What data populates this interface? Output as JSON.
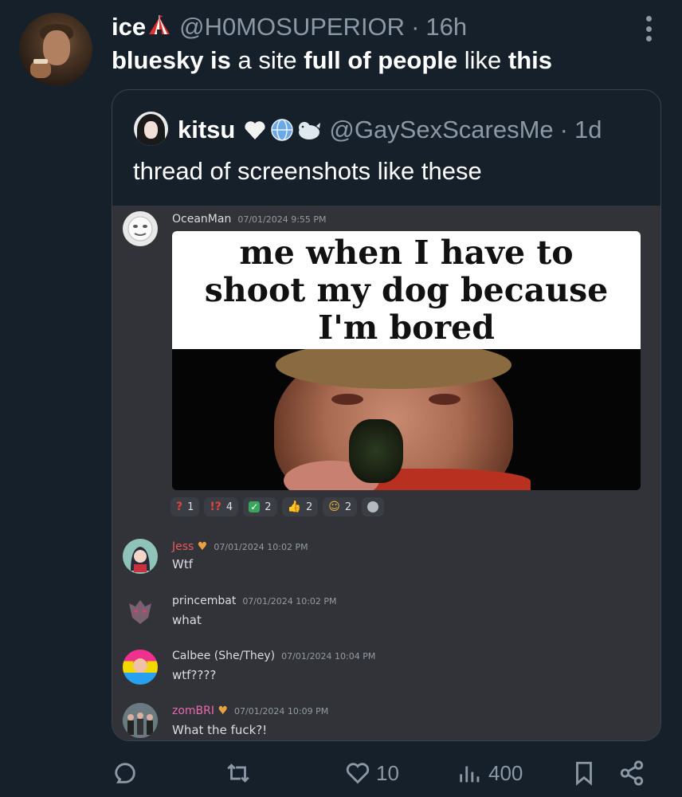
{
  "tweet": {
    "author_name": "ice",
    "author_handle": "@H0MOSUPERIOR",
    "separator": "·",
    "timestamp": "16h",
    "text_parts": [
      "bluesky is",
      " a site ",
      "full of people",
      " like ",
      "this"
    ]
  },
  "quote": {
    "author_name": "kitsu",
    "author_handle": "@GaySexScaresMe",
    "separator": "·",
    "timestamp": "1d",
    "text": "thread of screenshots like these"
  },
  "discord": {
    "first": {
      "username": "OceanMan",
      "timestamp": "07/01/2024 9:55 PM",
      "meme_lines": [
        "me when I have to",
        "shoot my dog because",
        "I'm bored"
      ]
    },
    "reactions": [
      {
        "icon": "?",
        "count": "1",
        "color": "#e0443c"
      },
      {
        "icon": "!?",
        "count": "4",
        "color": "#e0443c"
      },
      {
        "icon": "✓",
        "count": "2",
        "color": "#ffffff"
      },
      {
        "icon": "👍",
        "count": "2",
        "color": "#f2b835"
      },
      {
        "icon": "☺",
        "count": "2",
        "color": "#f2b835"
      }
    ],
    "messages": [
      {
        "username": "Jess",
        "name_color": "#e85a5a",
        "timestamp": "07/01/2024 10:02 PM",
        "text": "Wtf"
      },
      {
        "username": "princembat",
        "name_color": "#dbdee1",
        "timestamp": "07/01/2024 10:02 PM",
        "text": "what"
      },
      {
        "username": "Calbee (She/They)",
        "name_color": "#dbdee1",
        "timestamp": "07/01/2024 10:04 PM",
        "text": "wtf????"
      },
      {
        "username": "zomBRI",
        "name_color": "#e86ab0",
        "timestamp": "07/01/2024 10:09 PM",
        "text": "What the fuck?!"
      }
    ]
  },
  "actions": {
    "likes": "10",
    "views": "400"
  },
  "icons": {
    "reply": "reply-icon",
    "retweet": "retweet-icon",
    "like": "heart-icon",
    "views": "views-icon",
    "bookmark": "bookmark-icon",
    "share": "share-icon"
  }
}
